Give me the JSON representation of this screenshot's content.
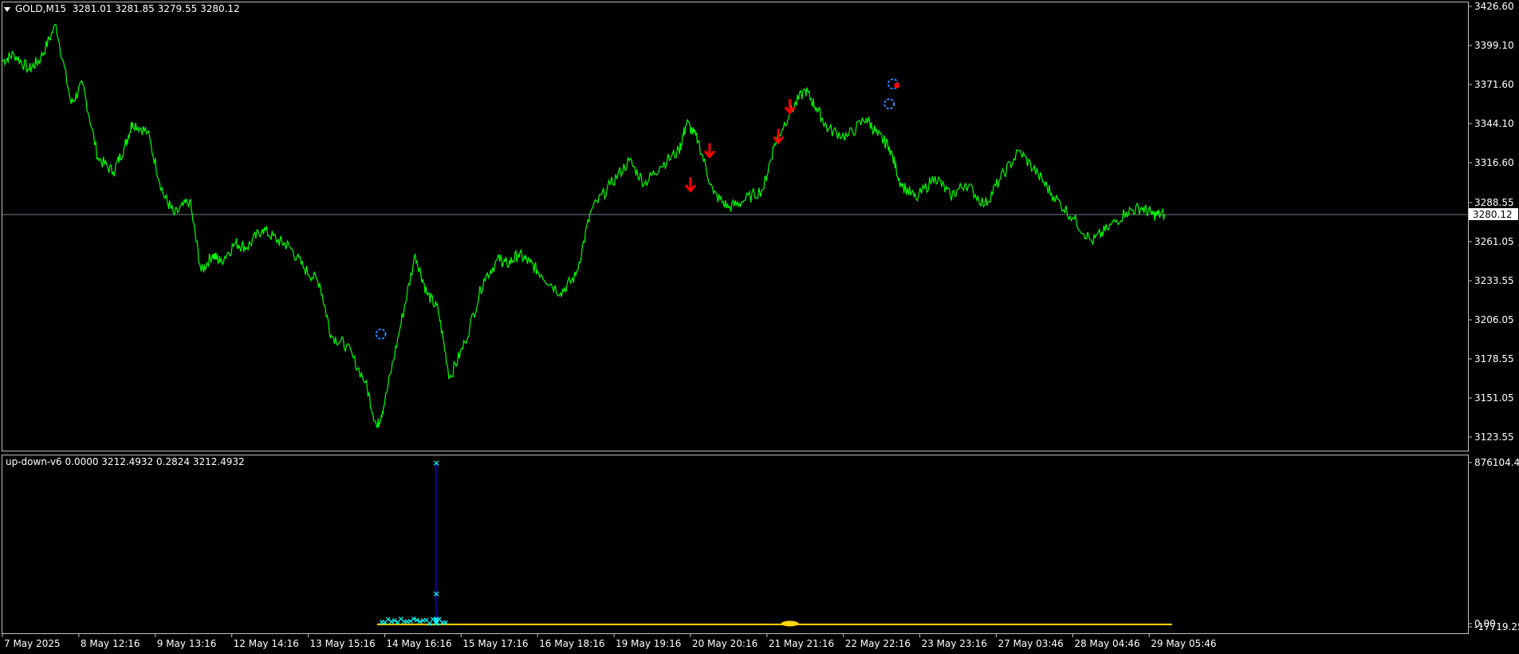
{
  "symbol_header": {
    "symbol": "GOLD,M15",
    "ohlc": "3281.01 3281.85 3279.55 3280.12"
  },
  "indicator_header": {
    "text": "up-down-v6 0.0000 3212.4932 0.2824 3212.4932"
  },
  "colors": {
    "background": "#000000",
    "frame": "#c0c0c0",
    "price_line": "#00ff00",
    "bid_line": "#708090",
    "down_arrow": "#ff0000",
    "sun_icon": "#1e90ff",
    "indicator_cross": "#00ffff",
    "indicator_blue": "#0000ff",
    "indicator_yellow": "#ffd700"
  },
  "chart_data": [
    {
      "type": "line",
      "title": "GOLD,M15",
      "ylim": [
        3110,
        3432
      ],
      "y_ticks": [
        "3426.60",
        "3399.10",
        "3371.60",
        "3344.10",
        "3316.60",
        "3288.55",
        "3261.05",
        "3233.55",
        "3206.05",
        "3178.55",
        "3151.05",
        "3123.55"
      ],
      "current_price_label": "3280.12",
      "current_price": 3280.12,
      "x_ticks": [
        "7 May 2025",
        "8 May 12:16",
        "9 May 13:16",
        "12 May 14:16",
        "13 May 15:16",
        "14 May 16:16",
        "15 May 17:16",
        "16 May 18:16",
        "19 May 19:16",
        "20 May 20:16",
        "21 May 21:16",
        "22 May 22:16",
        "23 May 23:16",
        "27 May 03:46",
        "28 May 04:46",
        "29 May 05:46"
      ],
      "x_range": [
        0,
        15.3
      ],
      "series": [
        {
          "x": [
            0,
            0.15,
            0.35,
            0.5,
            0.7,
            0.9,
            1.05,
            1.25,
            1.45,
            1.6,
            1.7,
            1.9,
            2.1,
            2.25,
            2.45,
            2.6,
            2.75,
            2.85,
            3.05,
            3.2,
            3.4,
            3.6,
            3.75,
            3.95,
            4.15,
            4.3,
            4.5,
            4.75,
            4.9,
            5.0,
            5.2,
            5.4,
            5.55,
            5.7,
            5.85,
            6.05,
            6.3,
            6.5,
            6.6,
            6.75,
            6.9,
            7.05,
            7.3,
            7.5,
            7.7,
            7.95,
            8.2,
            8.4,
            8.6,
            8.85,
            8.95,
            9.1,
            9.3,
            9.5,
            9.7,
            9.95,
            10.1,
            10.3,
            10.5,
            10.65,
            10.8,
            11.05,
            11.3,
            11.45,
            11.6,
            11.75,
            11.95,
            12.2,
            12.4,
            12.6,
            12.85,
            13.05,
            13.3,
            13.55,
            13.75,
            14.0,
            14.25,
            14.45,
            14.7,
            14.9,
            15.05,
            15.2
          ],
          "y": [
            3388,
            3393,
            3382,
            3390,
            3414,
            3358,
            3372,
            3320,
            3310,
            3328,
            3345,
            3338,
            3295,
            3280,
            3290,
            3240,
            3252,
            3247,
            3260,
            3257,
            3270,
            3262,
            3258,
            3242,
            3232,
            3195,
            3188,
            3162,
            3130,
            3148,
            3200,
            3252,
            3225,
            3213,
            3165,
            3190,
            3235,
            3249,
            3245,
            3252,
            3246,
            3238,
            3225,
            3237,
            3283,
            3301,
            3318,
            3302,
            3314,
            3325,
            3345,
            3332,
            3295,
            3285,
            3290,
            3298,
            3330,
            3352,
            3368,
            3355,
            3340,
            3335,
            3348,
            3336,
            3328,
            3302,
            3291,
            3307,
            3293,
            3302,
            3287,
            3305,
            3325,
            3308,
            3293,
            3278,
            3261,
            3270,
            3282,
            3285,
            3280,
            3280.12
          ]
        }
      ],
      "markers": [
        {
          "kind": "sun",
          "x": 4.95,
          "y": 3196
        },
        {
          "kind": "down_arrow",
          "x": 9.0,
          "y": 3294
        },
        {
          "kind": "down_arrow",
          "x": 9.25,
          "y": 3318
        },
        {
          "kind": "down_arrow",
          "x": 10.15,
          "y": 3328
        },
        {
          "kind": "down_arrow",
          "x": 10.3,
          "y": 3349
        },
        {
          "kind": "sun",
          "x": 11.65,
          "y": 3372
        },
        {
          "kind": "sun",
          "x": 11.6,
          "y": 3358
        },
        {
          "kind": "red_dot",
          "x": 11.7,
          "y": 3371
        }
      ]
    },
    {
      "type": "line",
      "title": "up-down-v6",
      "y_ticks": [
        "876104.42",
        "0.00",
        "-17719.25"
      ],
      "ylim": [
        -17719.25,
        876104.42
      ],
      "spike": {
        "x": 5.67,
        "top": 876104.42,
        "crosses": [
          876104.42,
          165000,
          28000,
          10000,
          4000
        ]
      },
      "crosses_cluster": {
        "x_start": 4.95,
        "x_end": 5.8,
        "value": 0
      },
      "yellow_line": {
        "x_start": 4.9,
        "x_end": 15.3,
        "value": 0
      },
      "yellow_blob": {
        "x": 10.3,
        "value": 0
      }
    }
  ]
}
